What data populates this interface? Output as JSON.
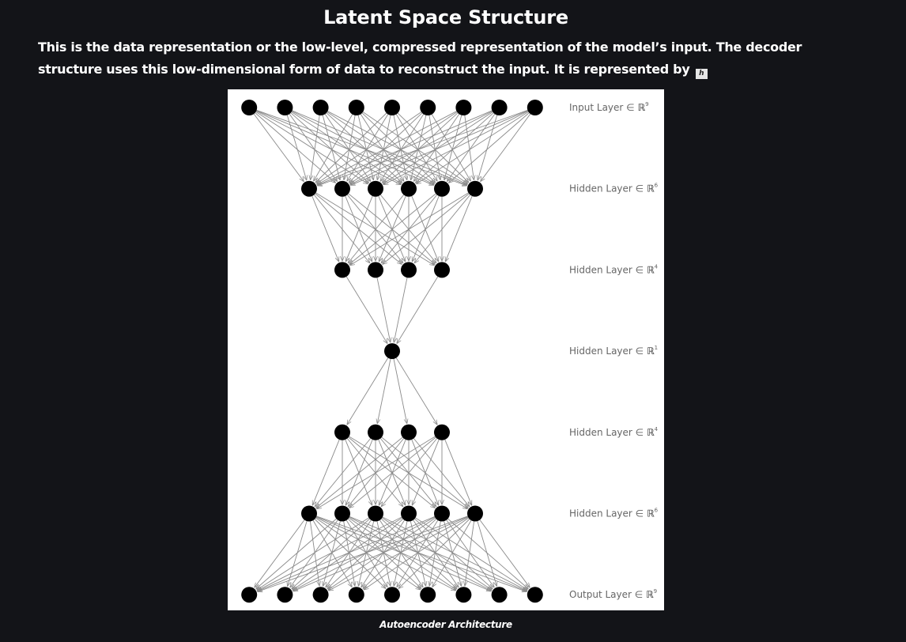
{
  "heading": "Latent Space Structure",
  "description": "This is the data representation or the low-level, compressed representation of the model’s input. The decoder structure uses this low-dimensional form of data to reconstruct the input. It is represented by",
  "symbol": "h",
  "figure": {
    "caption": "Autoencoder Architecture",
    "layers": [
      {
        "name": "Input Layer",
        "dim": "9",
        "nodes": 9
      },
      {
        "name": "Hidden Layer",
        "dim": "6",
        "nodes": 6
      },
      {
        "name": "Hidden Layer",
        "dim": "4",
        "nodes": 4
      },
      {
        "name": "Hidden Layer",
        "dim": "1",
        "nodes": 1
      },
      {
        "name": "Hidden Layer",
        "dim": "4",
        "nodes": 4
      },
      {
        "name": "Hidden Layer",
        "dim": "6",
        "nodes": 6
      },
      {
        "name": "Output Layer",
        "dim": "9",
        "nodes": 9
      }
    ],
    "set_symbol": "∈",
    "field_symbol": "ℝ",
    "colors": {
      "background": "#131418",
      "panel": "#ffffff",
      "node": "#000000",
      "edge": "#8a8a8a",
      "label": "#666666"
    }
  }
}
